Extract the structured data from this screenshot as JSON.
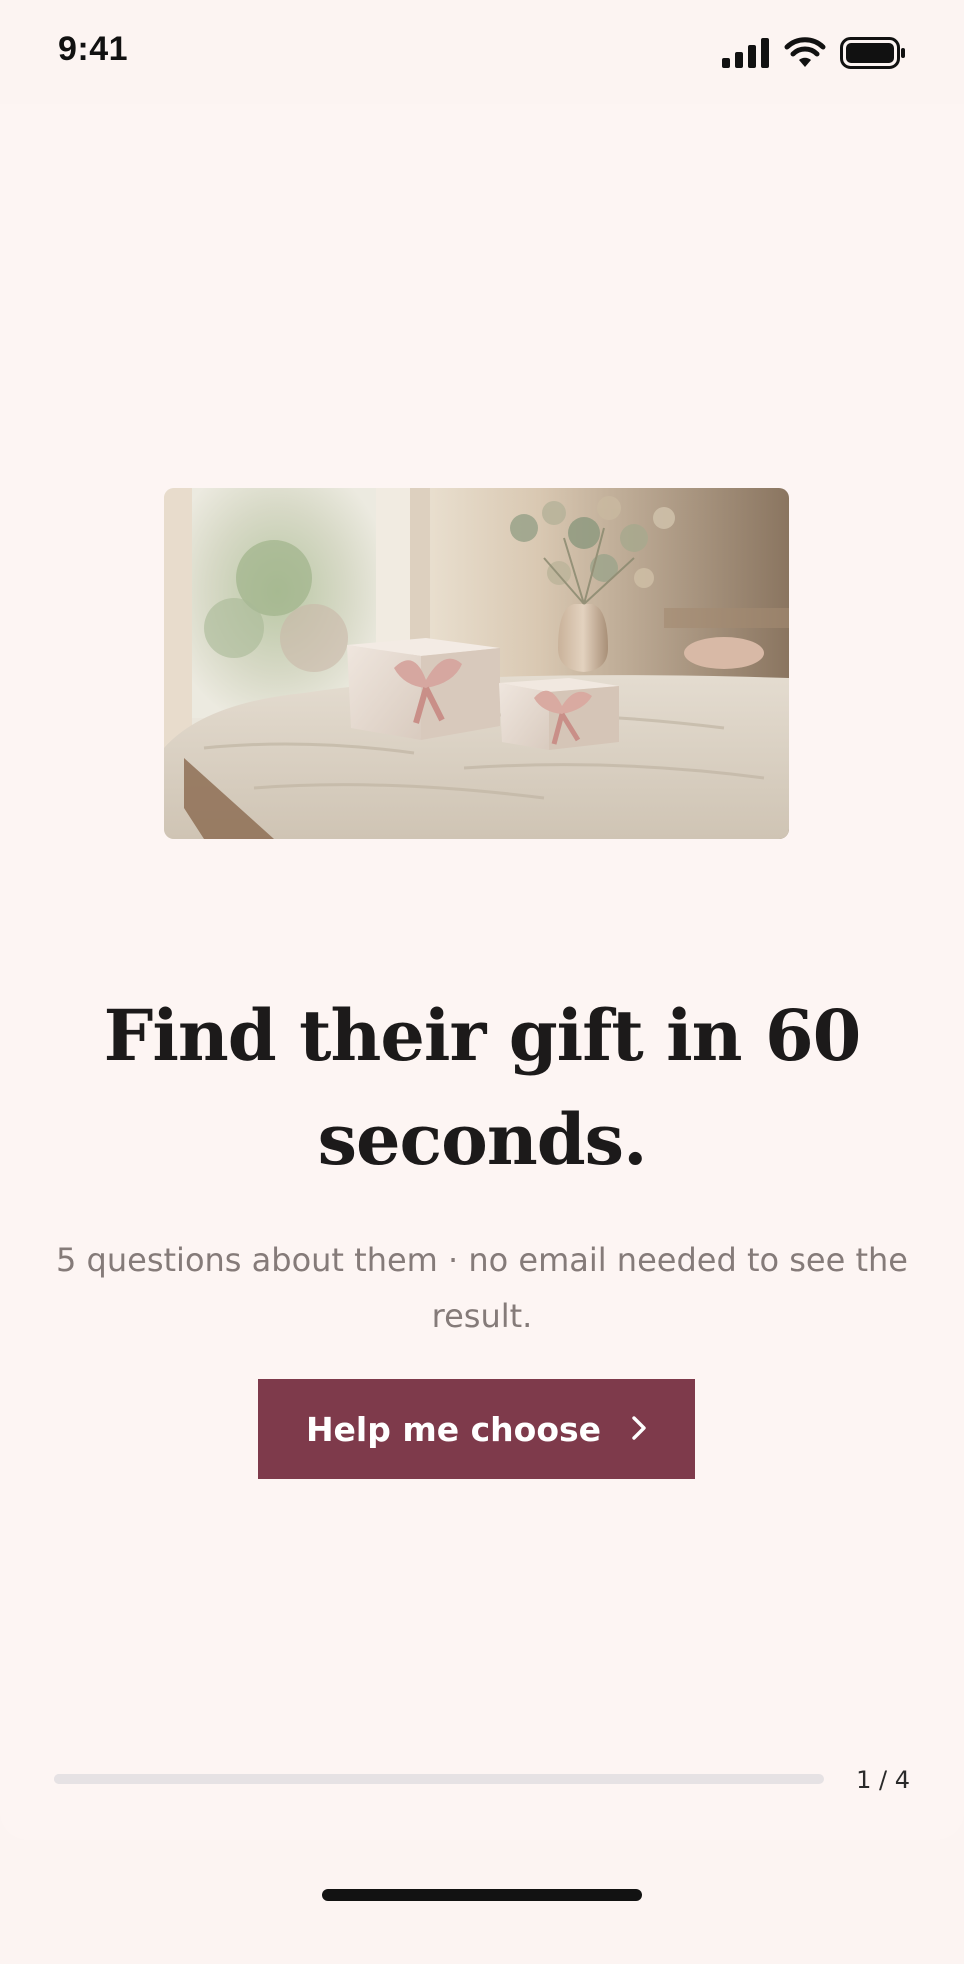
{
  "status_bar": {
    "time": "9:41",
    "icons": [
      "cellular-signal-icon",
      "wifi-icon",
      "battery-icon"
    ]
  },
  "hero": {
    "image_description_icon": "gift-boxes-photo",
    "headline": "Find their gift in 60 seconds.",
    "subtitle": "5 questions about them · no email needed to see the result."
  },
  "cta": {
    "label": "Help me choose",
    "icon": "chevron-right-icon"
  },
  "progress": {
    "label": "1 / 4",
    "current": 1,
    "total": 4
  },
  "colors": {
    "background": "#fcf4f2",
    "accent": "#7e3a4b",
    "headline": "#1c1a1a",
    "subtitle": "#857b79",
    "track": "#e6e2e4"
  }
}
